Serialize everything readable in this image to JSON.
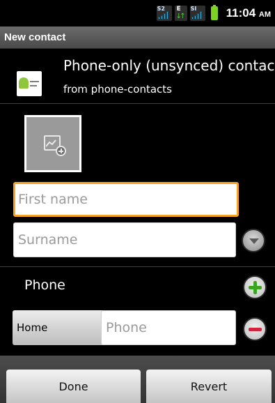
{
  "status_bar": {
    "network_1": "S2",
    "data_type": "E",
    "network_2": "SI",
    "time": "11:04",
    "ampm": "AM",
    "icons": [
      "signal-icon",
      "data-transfer-icon",
      "signal-icon",
      "battery-icon"
    ],
    "battery_color": "#7ed322"
  },
  "title_bar": {
    "title": "New contact"
  },
  "account": {
    "title": "Phone-only (unsynced) contact",
    "subtitle": "from phone-contacts"
  },
  "name_fields": {
    "first_name_placeholder": "First name",
    "surname_placeholder": "Surname"
  },
  "phone_section": {
    "label": "Phone",
    "type": "Home",
    "phone_placeholder": "Phone"
  },
  "actions": {
    "done_label": "Done",
    "revert_label": "Revert"
  },
  "colors": {
    "focus_border": "#f7a326",
    "add_green": "#3aa620",
    "remove_red": "#d4233d"
  }
}
